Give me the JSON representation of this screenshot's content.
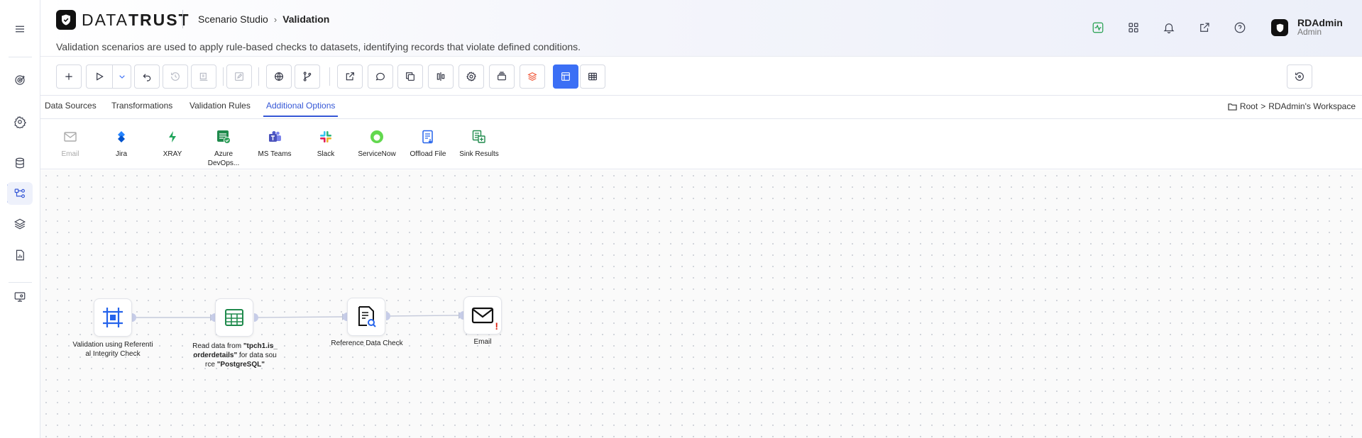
{
  "header": {
    "brand_light": "DATA",
    "brand_bold": "TRUST",
    "breadcrumb_parent": "Scenario Studio",
    "breadcrumb_current": "Validation",
    "subtitle": "Validation scenarios are used to apply rule-based checks to datasets, identifying records that violate defined conditions.",
    "user_name": "RDAdmin",
    "user_role": "Admin",
    "icons": [
      "activity-icon",
      "apps-grid-icon",
      "bell-icon",
      "external-link-icon",
      "help-icon"
    ]
  },
  "tabs": [
    {
      "label": "Data Sources",
      "active": false
    },
    {
      "label": "Transformations",
      "active": false
    },
    {
      "label": "Validation Rules",
      "active": false
    },
    {
      "label": "Additional Options",
      "active": true
    }
  ],
  "path": {
    "root": "Root",
    "separator": ">",
    "workspace": "RDAdmin's Workspace"
  },
  "options": [
    {
      "label": "Email",
      "icon": "email-icon",
      "enabled": false
    },
    {
      "label": "Jira",
      "icon": "jira-icon",
      "enabled": true
    },
    {
      "label": "XRAY",
      "icon": "xray-icon",
      "enabled": true
    },
    {
      "label": "Azure DevOps...",
      "icon": "azure-devops-icon",
      "enabled": true
    },
    {
      "label": "MS Teams",
      "icon": "ms-teams-icon",
      "enabled": true
    },
    {
      "label": "Slack",
      "icon": "slack-icon",
      "enabled": true
    },
    {
      "label": "ServiceNow",
      "icon": "servicenow-icon",
      "enabled": true
    },
    {
      "label": "Offload File",
      "icon": "offload-file-icon",
      "enabled": true
    },
    {
      "label": "Sink Results",
      "icon": "sink-results-icon",
      "enabled": true
    }
  ],
  "nodes": [
    {
      "id": "referential-integrity",
      "label": "Validation using Referential Integrity Check",
      "icon": "target-frame-icon"
    },
    {
      "id": "read-data",
      "label_pre": "Read data from ",
      "table": "\"tpch1.is_orderdetails\"",
      "label_mid": " for data source ",
      "source": "\"PostgreSQL\"",
      "icon": "table-icon"
    },
    {
      "id": "reference-data-check",
      "label": "Reference Data Check",
      "icon": "document-search-icon"
    },
    {
      "id": "email",
      "label": "Email",
      "icon": "envelope-icon",
      "warning": "!"
    }
  ]
}
